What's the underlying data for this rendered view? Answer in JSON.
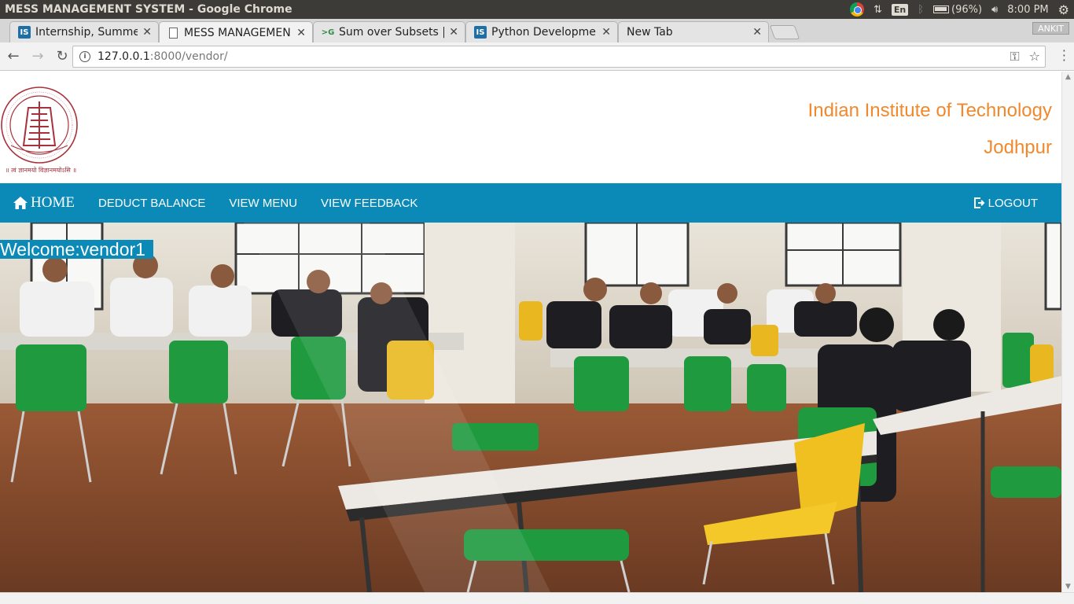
{
  "os": {
    "window_title": "MESS MANAGEMENT SYSTEM - Google Chrome",
    "battery": "(96%)",
    "time": "8:00 PM",
    "language": "En",
    "profile": "ANKIT"
  },
  "browser": {
    "tabs": [
      {
        "label": "Internship, Summer",
        "favicon": "is-favicon"
      },
      {
        "label": "MESS MANAGEMEN",
        "favicon": "document-favicon"
      },
      {
        "label": "Sum over Subsets |",
        "favicon": "gfg-favicon"
      },
      {
        "label": "Python Developme",
        "favicon": "is-favicon"
      },
      {
        "label": "New Tab",
        "favicon": ""
      }
    ],
    "url_host": "127.0.0.1",
    "url_path": ":8000/vendor/"
  },
  "header": {
    "institute_name": "Indian Institute of Technology",
    "institute_city": "Jodhpur",
    "logo_text": "Indian Institute of Technology Jodhpur",
    "logo_motto": "॥ त्वं ज्ञानमयो विज्ञानमयोऽसि ॥"
  },
  "nav": {
    "home": "HOME",
    "deduct_balance": "DEDUCT BALANCE",
    "view_menu": "VIEW MENU",
    "view_feedback": "VIEW FEEDBACK",
    "logout": "LOGOUT"
  },
  "welcome_text": "Welcome:vendor1",
  "colors": {
    "accent": "#0b8ab8",
    "institute_text": "#f0892e",
    "logo": "#a8323c"
  }
}
